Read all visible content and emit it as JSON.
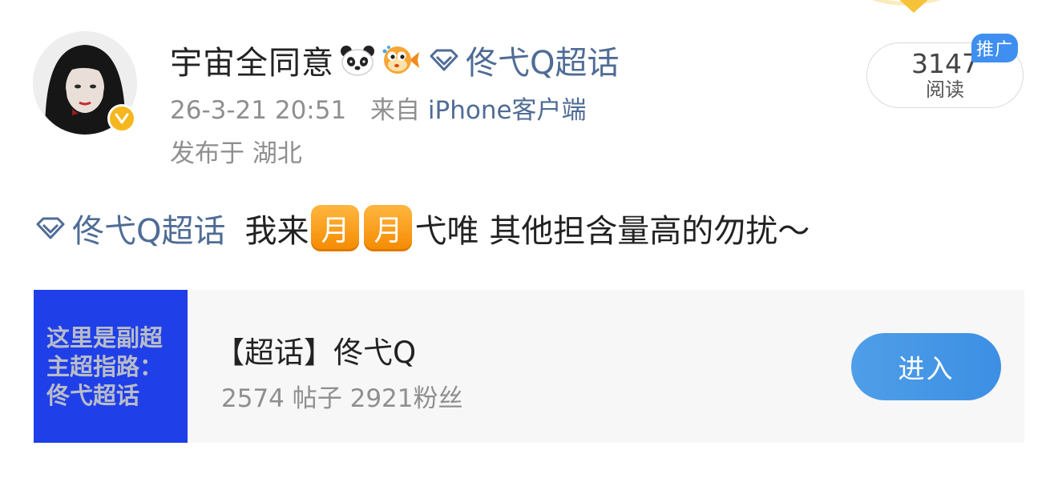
{
  "post": {
    "user_name": "宇宙全同意",
    "header_topic": "佟弋Q超话",
    "timestamp": "26-3-21 20:51",
    "source_prefix": "来自",
    "source_name": "iPhone客户端",
    "location": "发布于 湖北",
    "reads_count": "3147",
    "reads_label": "阅读",
    "promo_badge": "推广",
    "body": {
      "topic": "佟弋Q超话",
      "text_lead": "我来",
      "emoji_tile_1": "月",
      "emoji_tile_2": "月",
      "text_trail": "弋唯 其他担含量高的勿扰～"
    }
  },
  "card": {
    "thumbnail_lines": [
      "这里是副超",
      "主超指路：",
      "佟弋超话"
    ],
    "title": "【超话】佟弋Q",
    "stats": "2574 帖子 2921粉丝",
    "enter_label": "进入"
  },
  "colors": {
    "link": "#4f6c95",
    "verified": "#f6b71e",
    "accent": "#3f8ff0",
    "thumbnail_bg": "#1f3fe8"
  },
  "icons": {
    "verified": "verified-v-icon",
    "topic": "diamond-icon",
    "emoji_1": "panda-icon",
    "emoji_2": "pufferfish-icon"
  }
}
